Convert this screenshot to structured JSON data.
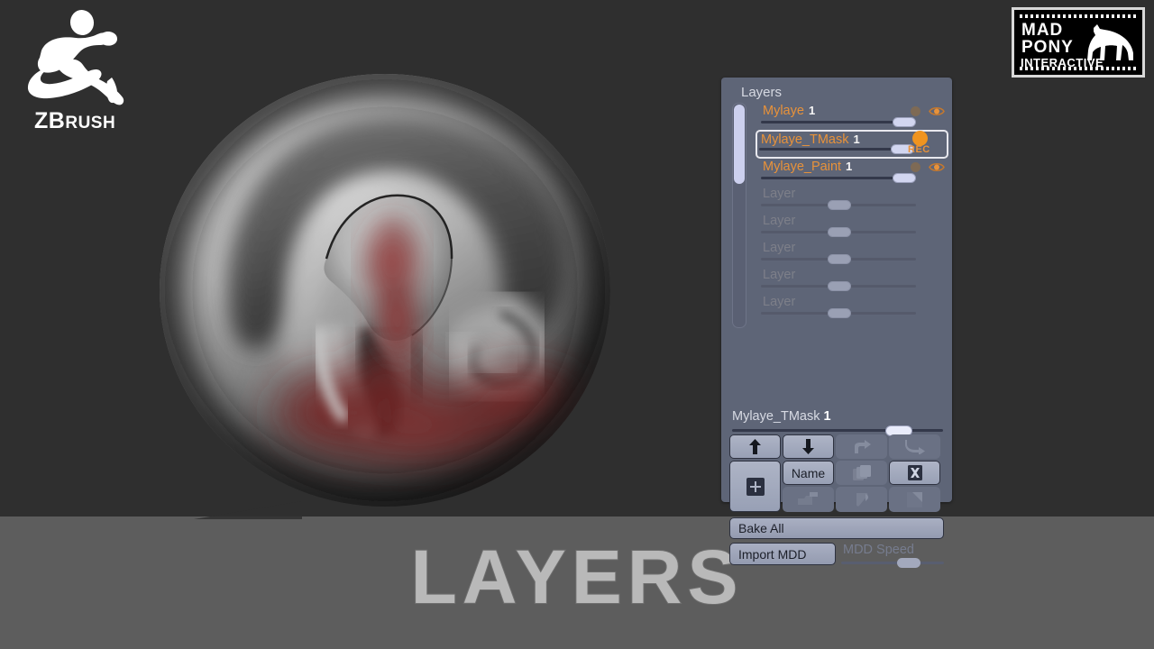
{
  "branding": {
    "zbrush": {
      "icon": "zbrush-running-figure-logo",
      "word_z": "Z",
      "word_brush_b": "B",
      "word_brush_rest": "RUSH"
    },
    "madpony": {
      "line1": "MAD",
      "line2": "PONY",
      "line3": "INTERACTIVE",
      "icon": "horse-silhouette-icon"
    }
  },
  "canvas": {
    "object_name": "sculpted-ear-sphere",
    "background_top_color": "#2f2f2f",
    "background_bottom_color": "#5d5d5d"
  },
  "title": {
    "text": "LAYERS",
    "color": "#b9b9b9",
    "outline_color": "#6e6e6e"
  },
  "palette": {
    "title": "Layers",
    "accent_color": "#e8923a",
    "panel_color": "#5e6577",
    "scroll": {
      "thumb_position_pct": 0,
      "thumb_size_pct": 35
    },
    "layers": [
      {
        "name": "Mylaye",
        "intensity": "1",
        "slider_pct": 84,
        "enabled": true,
        "recording": false,
        "visible": true,
        "dot_icon": "record-dot-icon",
        "eye_icon": "eye-visible-icon"
      },
      {
        "name": "Mylaye_TMask",
        "intensity": "1",
        "slider_pct": 84,
        "enabled": true,
        "recording": true,
        "visible": true,
        "rec_label": "REC",
        "dot_icon": "record-dot-active-icon",
        "selected": true
      },
      {
        "name": "Mylaye_Paint",
        "intensity": "1",
        "slider_pct": 84,
        "enabled": true,
        "recording": false,
        "visible": true,
        "dot_icon": "record-dot-icon",
        "eye_icon": "eye-visible-icon"
      },
      {
        "name": "Layer",
        "intensity": "",
        "slider_pct": 44,
        "enabled": false
      },
      {
        "name": "Layer",
        "intensity": "",
        "slider_pct": 44,
        "enabled": false
      },
      {
        "name": "Layer",
        "intensity": "",
        "slider_pct": 44,
        "enabled": false
      },
      {
        "name": "Layer",
        "intensity": "",
        "slider_pct": 44,
        "enabled": false
      },
      {
        "name": "Layer",
        "intensity": "",
        "slider_pct": 44,
        "enabled": false
      }
    ],
    "active_slider": {
      "label": "Mylaye_TMask",
      "value": "1",
      "position_pct": 73
    },
    "buttons": {
      "move_up": {
        "label": "",
        "icon": "arrow-up-icon",
        "enabled": true
      },
      "move_down": {
        "label": "",
        "icon": "arrow-down-icon",
        "enabled": true
      },
      "split_right": {
        "label": "",
        "icon": "arrow-turn-right-icon",
        "enabled": false
      },
      "merge_down": {
        "label": "",
        "icon": "arrow-curve-down-icon",
        "enabled": false
      },
      "new_layer": {
        "label": "",
        "icon": "new-layer-plus-icon",
        "enabled": true
      },
      "rename": {
        "label": "Name",
        "icon": "rename-icon",
        "enabled": true
      },
      "duplicate": {
        "label": "",
        "icon": "duplicate-layers-icon",
        "enabled": false
      },
      "delete": {
        "label": "",
        "icon": "delete-layer-x-icon",
        "enabled": true
      },
      "split_hidden": {
        "label": "",
        "icon": "split-layer-icon",
        "enabled": false
      },
      "bake_layer": {
        "label": "",
        "icon": "bake-layer-icon",
        "enabled": false
      },
      "copy_layer": {
        "label": "",
        "icon": "copy-layer-icon",
        "enabled": false
      }
    },
    "bake_all": {
      "label": "Bake All",
      "enabled": true
    },
    "import_mdd": {
      "label": "Import MDD",
      "enabled": true
    },
    "mdd_speed": {
      "label": "MDD Speed",
      "enabled": false,
      "position_pct": 55
    }
  }
}
